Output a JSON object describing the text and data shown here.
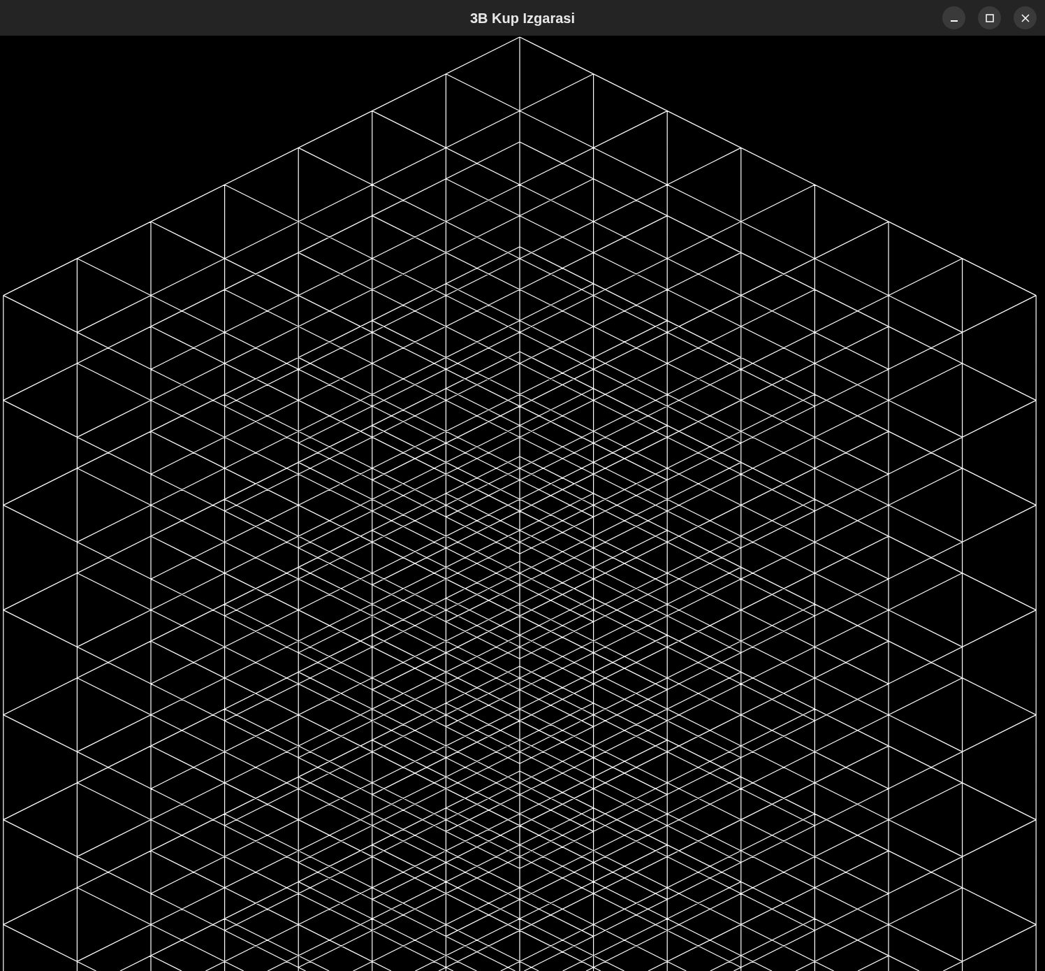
{
  "window": {
    "title": "3B Kup Izgarasi"
  }
}
